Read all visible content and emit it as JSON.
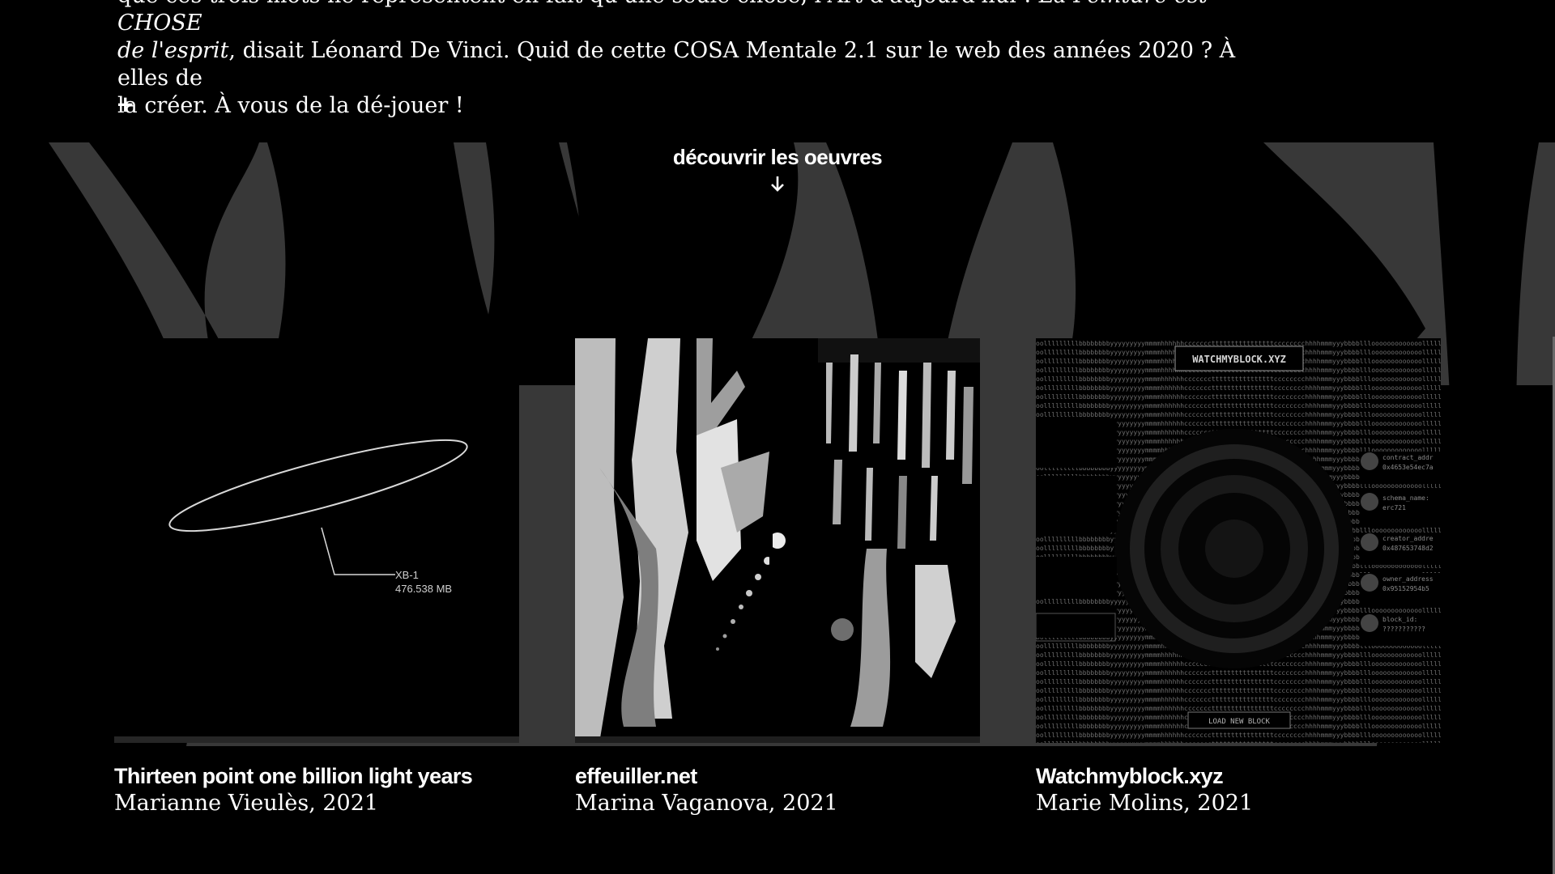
{
  "intro": {
    "line1_plain": "que ces trois mots ne représentent en fait qu'une seule chose, l'Art d'aujourd'hui ! ",
    "quote_italic_a": "La Peinture est CHOSE",
    "quote_italic_b": "de l'esprit",
    "line2_rest": ", disait Léonard De Vinci. Quid de cette COSA Mentale 2.1 sur le web des années 2020 ? À elles de",
    "line3": "la créer. À vous de la dé-jouer !"
  },
  "toggle": {
    "label": "+"
  },
  "discover": {
    "label": "découvrir les oeuvres",
    "icon": "arrow-down-icon"
  },
  "works": [
    {
      "title": "Thirteen point one billion light years",
      "meta": "Marianne Vieulès, 2021",
      "thumb": {
        "tag": "XB-1",
        "size": "476.538 MB"
      }
    },
    {
      "title": "effeuiller.net",
      "meta": "Marina Vaganova, 2021"
    },
    {
      "title": "Watchmyblock.xyz",
      "meta": "Marie Molins, 2021",
      "thumb": {
        "header": "WATCHMYBLOCK.XYZ",
        "button": "LOAD NEW BLOCK",
        "fields": [
          {
            "label": "contract_addr",
            "value": "0x4653e54ec7a"
          },
          {
            "label": "schema_name:",
            "value": "erc721"
          },
          {
            "label": "creator_addre",
            "value": "0x487653748d2"
          },
          {
            "label": "owner_address",
            "value": "0x95152954b5"
          },
          {
            "label": "block_id:",
            "value": "???????????"
          }
        ]
      }
    }
  ],
  "colors": {
    "background": "#000000",
    "band": "#3a3a3a",
    "text": "#ffffff"
  }
}
